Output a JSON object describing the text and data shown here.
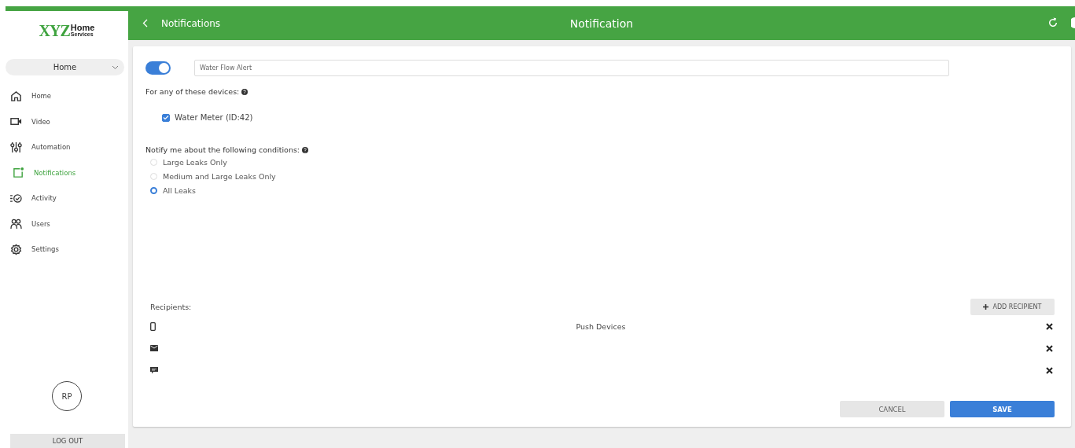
{
  "sidebar": {
    "logo": {
      "mark": "XYZ",
      "line1": "Home",
      "line2": "Services"
    },
    "location_select": {
      "value": "Home"
    },
    "nav": [
      {
        "kind": "home",
        "label": "Home",
        "selected": false
      },
      {
        "kind": "video",
        "label": "Video",
        "selected": false
      },
      {
        "kind": "automation",
        "label": "Automation",
        "selected": false
      },
      {
        "kind": "notifications",
        "label": "Notifications",
        "selected": true
      },
      {
        "kind": "activity",
        "label": "Activity",
        "selected": false
      },
      {
        "kind": "users",
        "label": "Users",
        "selected": false
      },
      {
        "kind": "settings",
        "label": "Settings",
        "selected": false
      }
    ],
    "avatar": "RP",
    "logout": "LOG OUT"
  },
  "header": {
    "back_label": "Notifications",
    "title": "Notification"
  },
  "form": {
    "enabled": true,
    "name": "Water Flow Alert",
    "devices_label": "For any of these devices:",
    "devices": [
      {
        "label": "Water Meter (ID:42)",
        "checked": true
      }
    ],
    "conditions_label": "Notify me about the following conditions:",
    "conditions": [
      {
        "label": "Large Leaks Only",
        "selected": false
      },
      {
        "label": "Medium and Large Leaks Only",
        "selected": false
      },
      {
        "label": "All Leaks",
        "selected": true
      }
    ],
    "recipients_label": "Recipients:",
    "add_recipient": "ADD RECIPIENT",
    "recipients": [
      {
        "kind": "push",
        "text": "Push Devices"
      },
      {
        "kind": "email"
      },
      {
        "kind": "sms"
      }
    ]
  },
  "buttons": {
    "cancel": "CANCEL",
    "save": "SAVE"
  }
}
